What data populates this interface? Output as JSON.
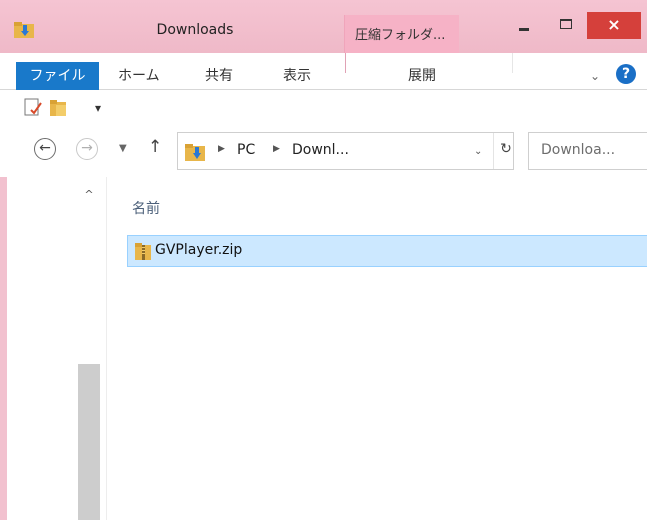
{
  "window": {
    "title": "Downloads",
    "context_tab": "圧縮フォルダ...",
    "close_glyph": "×"
  },
  "ribbon": {
    "file_tab": "ファイル",
    "tabs": [
      "ホーム",
      "共有",
      "表示",
      "展開"
    ],
    "collapse_glyph": "⌄",
    "help_glyph": "?"
  },
  "quick_access": {
    "dropdown_glyph": "▾"
  },
  "nav": {
    "back_glyph": "←",
    "forward_glyph": "→",
    "recent_glyph": "▼",
    "up_glyph": "↑"
  },
  "address": {
    "separator_glyph": "▶",
    "crumbs": [
      "PC",
      "Downl..."
    ],
    "dropdown_glyph": "⌄",
    "refresh_glyph": "↻"
  },
  "search": {
    "text": "Downloa..."
  },
  "navpane": {
    "scroll_up_glyph": "^"
  },
  "filelist": {
    "column_header": "名前",
    "items": [
      {
        "name": "GVPlayer.zip",
        "selected": true
      }
    ]
  },
  "colors": {
    "accent": "#1979ca",
    "title_bar": "#f5c4d2",
    "close_button": "#d5403b",
    "selection": "#cce8ff"
  }
}
